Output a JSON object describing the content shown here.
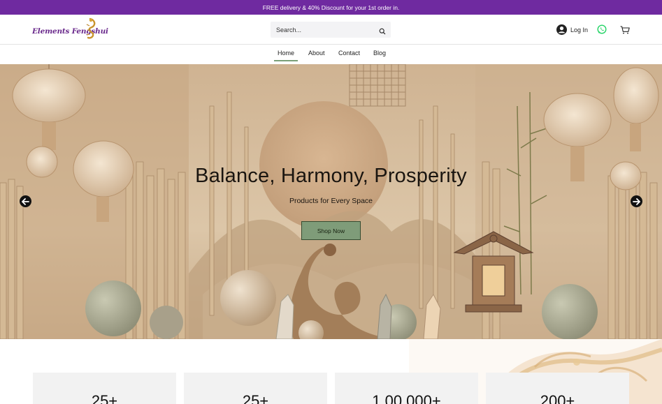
{
  "promo": {
    "text": "FREE delivery & 40% Discount for your 1st order in."
  },
  "header": {
    "logo_text": "Elements Fengshui",
    "search_placeholder": "Search...",
    "login_label": "Log In"
  },
  "nav": {
    "items": [
      {
        "label": "Home",
        "active": true
      },
      {
        "label": "About",
        "active": false
      },
      {
        "label": "Contact",
        "active": false
      },
      {
        "label": "Blog",
        "active": false
      }
    ]
  },
  "hero": {
    "title": "Balance, Harmony, Prosperity",
    "subtitle": "Products for Every Space",
    "button_label": "Shop Now"
  },
  "stats": [
    {
      "value": "25+"
    },
    {
      "value": "25+"
    },
    {
      "value": "1,00,000+"
    },
    {
      "value": "200+"
    }
  ],
  "colors": {
    "promo_bg": "#6f2aa0",
    "accent_green": "#7f9c79",
    "logo_purple": "#6a2a8c",
    "whatsapp_green": "#25d366"
  },
  "icons": [
    "search-icon",
    "user-avatar-icon",
    "whatsapp-icon",
    "cart-icon",
    "arrow-left-icon",
    "arrow-right-icon"
  ]
}
